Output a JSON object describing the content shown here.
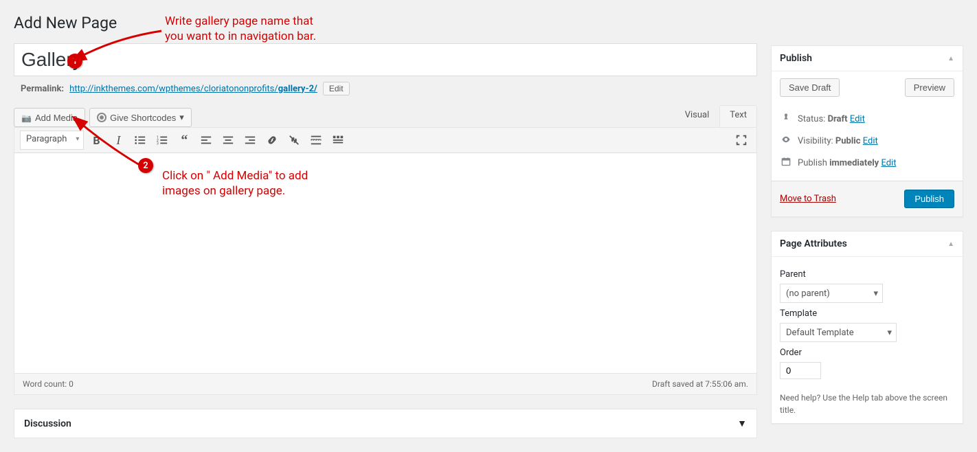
{
  "page": {
    "heading": "Add New Page",
    "title_value": "Gallery",
    "permalink_label": "Permalink:",
    "permalink_url_display": "http://inkthemes.com/wpthemes/cloriatononprofits/",
    "permalink_slug": "gallery-2/",
    "permalink_edit": "Edit",
    "add_media_label": "Add Media",
    "give_shortcodes_label": "Give Shortcodes",
    "tabs": {
      "visual": "Visual",
      "text": "Text"
    },
    "format_select": "Paragraph",
    "word_count_label": "Word count: 0",
    "draft_saved_label": "Draft saved at 7:55:06 am.",
    "discussion_label": "Discussion"
  },
  "publish": {
    "title": "Publish",
    "save_draft": "Save Draft",
    "preview": "Preview",
    "status_label": "Status:",
    "status_value": "Draft",
    "visibility_label": "Visibility:",
    "visibility_value": "Public",
    "publish_time_label": "Publish",
    "publish_time_value": "immediately",
    "edit": "Edit",
    "trash": "Move to Trash",
    "publish_btn": "Publish"
  },
  "attributes": {
    "title": "Page Attributes",
    "parent_label": "Parent",
    "parent_value": "(no parent)",
    "template_label": "Template",
    "template_value": "Default Template",
    "order_label": "Order",
    "order_value": "0",
    "help_text": "Need help? Use the Help tab above the screen title."
  },
  "annotations": {
    "a1": "Write gallery page name that you want to in navigation bar.",
    "a2": "Click on \" Add Media\" to add images on gallery page."
  }
}
